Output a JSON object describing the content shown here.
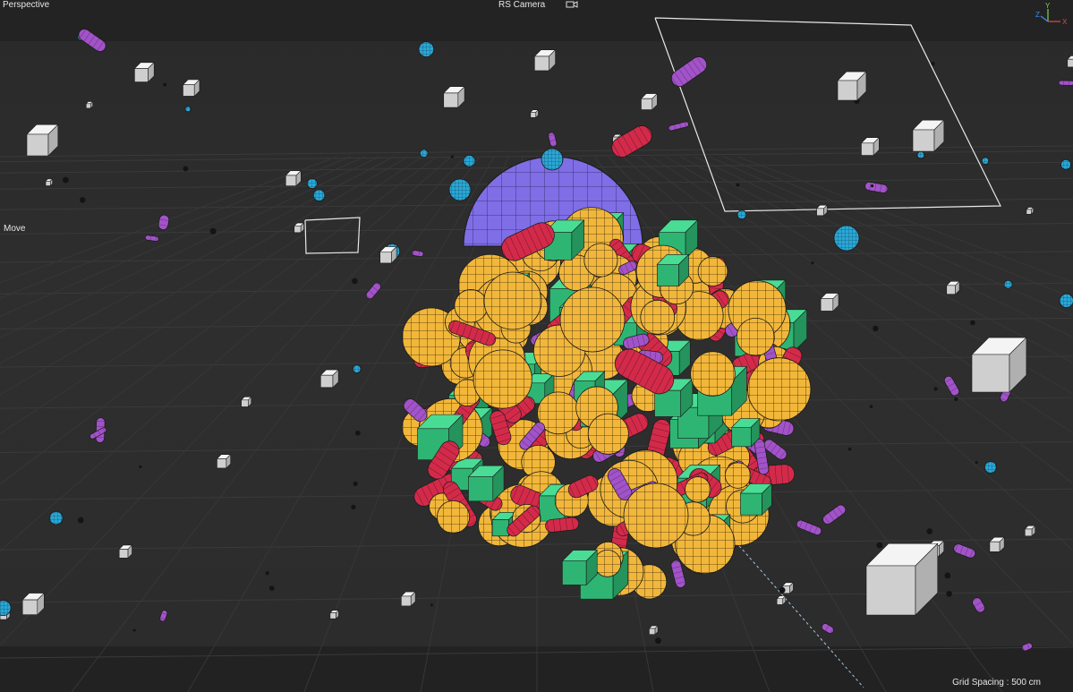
{
  "viewport": {
    "view_name": "Perspective",
    "camera_name": "RS Camera",
    "tool_label": "Move",
    "grid_spacing": "Grid Spacing : 500 cm"
  },
  "gizmo": {
    "axis_y": "Y",
    "axis_z": "Z",
    "axis_x": "X"
  },
  "colors": {
    "sphere_orange": "#f2b73a",
    "cube_green": "#3fd08a",
    "capsule_red": "#d42a4a",
    "capsule_purple": "#a253c9",
    "sphere_blue": "#2aa7d6",
    "big_sphere_violet": "#7f6ee6",
    "cube_white": "#eeeeee",
    "camera_frame": "#e8e8e8"
  }
}
